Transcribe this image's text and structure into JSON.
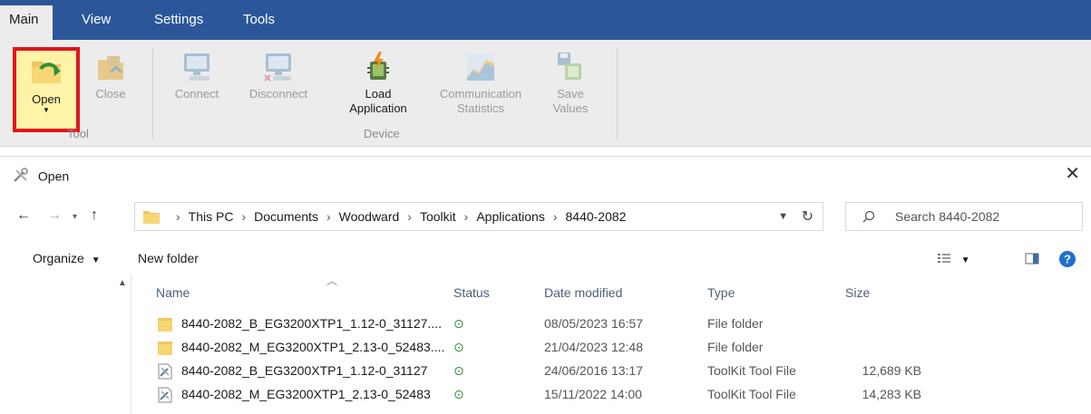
{
  "ribbon": {
    "tabs": [
      {
        "label": "Main",
        "active": true
      },
      {
        "label": "View",
        "active": false
      },
      {
        "label": "Settings",
        "active": false
      },
      {
        "label": "Tools",
        "active": false
      }
    ],
    "buttons": {
      "open": "Open",
      "close": "Close",
      "connect": "Connect",
      "disconnect": "Disconnect",
      "load_line1": "Load",
      "load_line2": "Application",
      "comm_line1": "Communication",
      "comm_line2": "Statistics",
      "save_line1": "Save",
      "save_line2": "Values"
    },
    "groups": {
      "tool": "Tool",
      "device": "Device"
    },
    "colors": {
      "tab_bar": "#2b579a",
      "highlight_border": "#e5121b",
      "highlight_fill": "#fff3a8"
    }
  },
  "dialog": {
    "title": "Open",
    "address": {
      "crumbs": [
        "This PC",
        "Documents",
        "Woodward",
        "Toolkit",
        "Applications",
        "8440-2082"
      ]
    },
    "search": {
      "placeholder": "Search 8440-2082"
    },
    "toolbar": {
      "organize": "Organize",
      "new_folder": "New folder"
    },
    "columns": {
      "name": "Name",
      "status": "Status",
      "date": "Date modified",
      "type": "Type",
      "size": "Size"
    },
    "files": [
      {
        "name": "8440-2082_B_EG3200XTP1_1.12-0_31127....",
        "icon": "folder-icon",
        "date": "08/05/2023 16:57",
        "type": "File folder",
        "size": ""
      },
      {
        "name": "8440-2082_M_EG3200XTP1_2.13-0_52483....",
        "icon": "folder-icon",
        "date": "21/04/2023 12:48",
        "type": "File folder",
        "size": ""
      },
      {
        "name": "8440-2082_B_EG3200XTP1_1.12-0_31127",
        "icon": "toolkit-file-icon",
        "date": "24/06/2016 13:17",
        "type": "ToolKit Tool File",
        "size": "12,689 KB"
      },
      {
        "name": "8440-2082_M_EG3200XTP1_2.13-0_52483",
        "icon": "toolkit-file-icon",
        "date": "15/11/2022 14:00",
        "type": "ToolKit Tool File",
        "size": "14,283 KB"
      }
    ]
  }
}
